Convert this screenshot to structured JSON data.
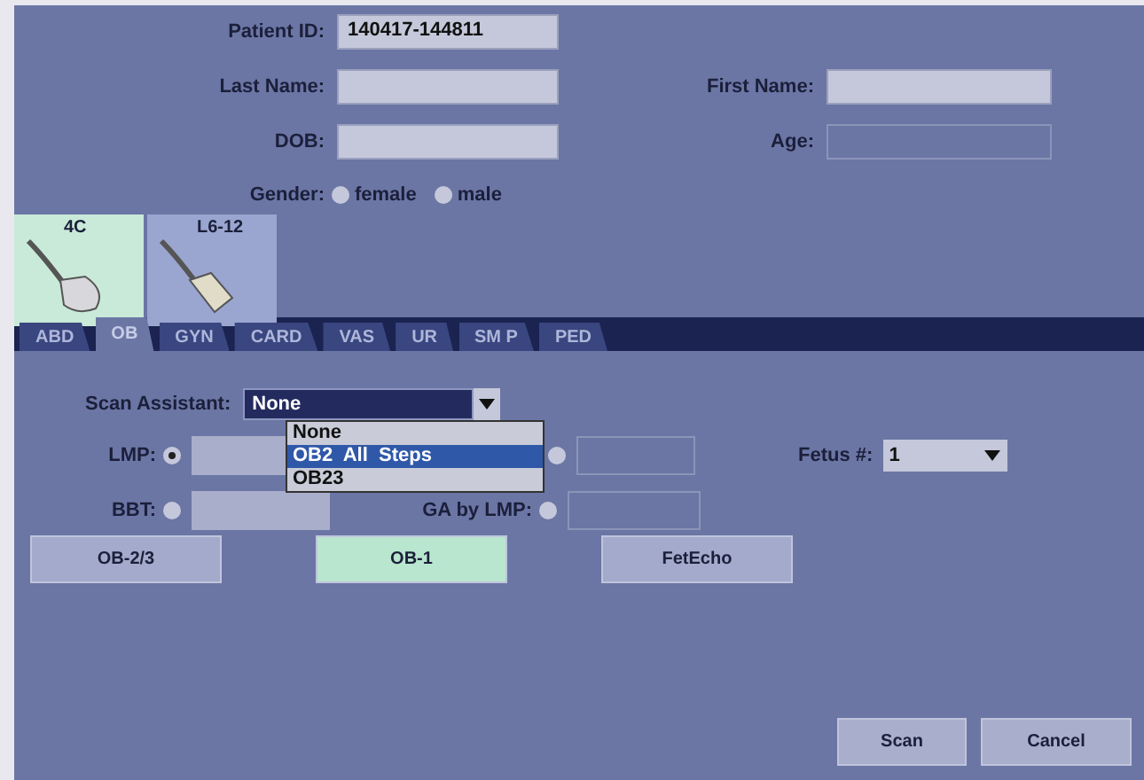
{
  "patient": {
    "fields": [
      {
        "label": "Patient ID:",
        "value": "140417-144811"
      },
      {
        "label": "Last Name:"
      },
      {
        "label": "First Name:"
      },
      {
        "label": "DOB:"
      },
      {
        "label": "Age:",
        "disabled": true
      }
    ],
    "gender": {
      "label": "Gender:",
      "options": [
        {
          "label": "female",
          "selected": false
        },
        {
          "label": "male",
          "selected": false
        }
      ]
    }
  },
  "probes": [
    {
      "label": "4C",
      "kind": "convex",
      "selected": true
    },
    {
      "label": "L6-12",
      "kind": "linear",
      "selected": false
    }
  ],
  "tabs": [
    {
      "label": "ABD",
      "selected": false
    },
    {
      "label": "OB",
      "selected": true
    },
    {
      "label": "GYN",
      "selected": false
    },
    {
      "label": "CARD",
      "selected": false
    },
    {
      "label": "VAS",
      "selected": false
    },
    {
      "label": "UR",
      "selected": false
    },
    {
      "label": "SM P",
      "selected": false
    },
    {
      "label": "PED",
      "selected": false
    }
  ],
  "scan_assistant": {
    "label": "Scan Assistant:",
    "value": "None",
    "expanded": true,
    "options": [
      {
        "label": "None",
        "highlighted": false
      },
      {
        "label": "OB2  All  Steps",
        "highlighted": true
      },
      {
        "label": "OB23",
        "highlighted": false
      }
    ]
  },
  "dating": [
    {
      "label": "LMP:",
      "selected": true
    },
    {
      "label": "BBT:",
      "selected": false
    }
  ],
  "dating_right": [
    {
      "selected": false
    },
    {
      "label": "GA by LMP:",
      "selected": false
    }
  ],
  "fetus": {
    "label": "Fetus #:",
    "value": "1"
  },
  "presets": [
    {
      "label": "OB-2/3",
      "selected": false
    },
    {
      "label": "OB-1",
      "selected": true
    },
    {
      "label": "FetEcho",
      "selected": false
    }
  ],
  "buttons": [
    "Scan",
    "Cancel"
  ]
}
